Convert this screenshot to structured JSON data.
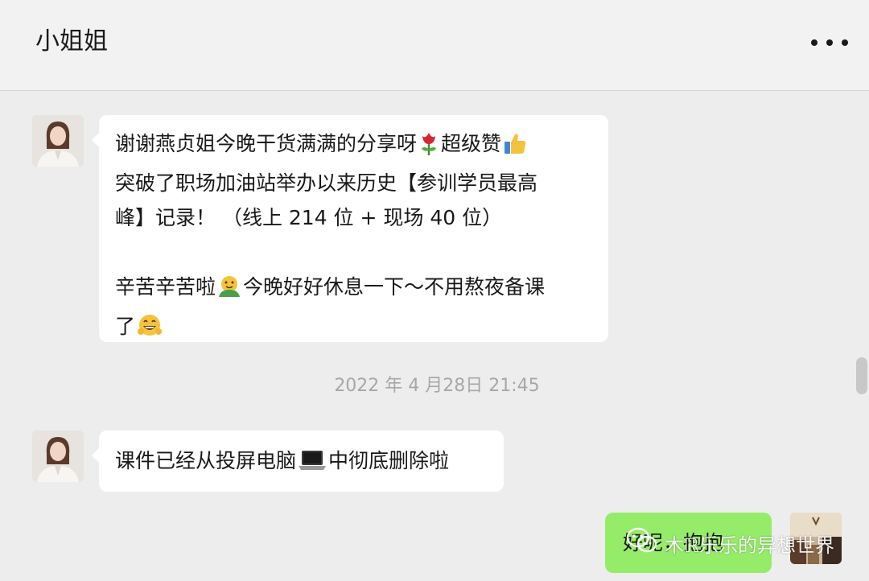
{
  "header": {
    "title": "小姐姐"
  },
  "messages": [
    {
      "lines": [
        "谢谢燕贞姐今晚干货满满的分享呀",
        "超级赞",
        "突破了职场加油站举办以来历史【参训学员最高",
        "峰】记录！ （线上 214 位 + 现场 40 位）",
        "辛苦辛苦啦",
        "今晚好好休息一下～不用熬夜备课",
        "了"
      ]
    },
    {
      "text_before": "课件已经从投屏电脑",
      "text_after": "中彻底删除啦"
    }
  ],
  "timestamp": "2022 年 4 月28日 21:45",
  "outgoing": {
    "text": "好呢，抱抱"
  },
  "watermark": {
    "text": "木ℝ乐乐的异想世界"
  },
  "icons": {
    "more": "more-dots-icon",
    "rose": "rose-emoji",
    "thumbs_up": "thumbs-up-emoji",
    "hug": "hug-emoji",
    "grin": "grin-emoji",
    "laptop": "laptop-emoji",
    "wechat": "wechat-logo-icon"
  }
}
